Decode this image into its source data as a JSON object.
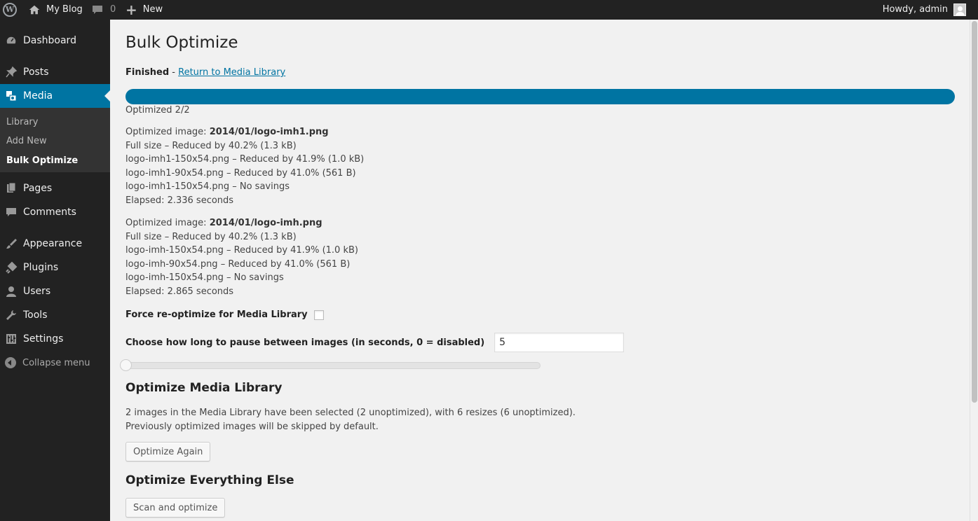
{
  "adminbar": {
    "site_name": "My Blog",
    "comments_count": "0",
    "new_label": "New",
    "howdy": "Howdy, admin"
  },
  "menu": {
    "items": [
      {
        "label": "Dashboard",
        "icon": "dashboard-icon"
      },
      {
        "label": "Posts",
        "icon": "pin-icon"
      },
      {
        "label": "Media",
        "icon": "media-icon"
      },
      {
        "label": "Pages",
        "icon": "pages-icon"
      },
      {
        "label": "Comments",
        "icon": "comment-icon"
      },
      {
        "label": "Appearance",
        "icon": "brush-icon"
      },
      {
        "label": "Plugins",
        "icon": "plug-icon"
      },
      {
        "label": "Users",
        "icon": "user-icon"
      },
      {
        "label": "Tools",
        "icon": "wrench-icon"
      },
      {
        "label": "Settings",
        "icon": "sliders-icon"
      }
    ],
    "submenu": [
      "Library",
      "Add New",
      "Bulk Optimize"
    ],
    "collapse": "Collapse menu"
  },
  "page": {
    "title": "Bulk Optimize",
    "status_label": "Finished",
    "status_sep": " - ",
    "return_link": "Return to Media Library",
    "progress_fraction": 1.0,
    "progress_text": "Optimized 2/2"
  },
  "log": [
    {
      "prefix": "Optimized image: ",
      "file": "2014/01/logo-imh1.png",
      "lines": [
        "Full size – Reduced by 40.2% (1.3 kB)",
        "logo-imh1-150x54.png – Reduced by 41.9% (1.0 kB)",
        "logo-imh1-90x54.png – Reduced by 41.0% (561 B)",
        "logo-imh1-150x54.png – No savings",
        "Elapsed: 2.336 seconds"
      ]
    },
    {
      "prefix": "Optimized image: ",
      "file": "2014/01/logo-imh.png",
      "lines": [
        "Full size – Reduced by 40.2% (1.3 kB)",
        "logo-imh-150x54.png – Reduced by 41.9% (1.0 kB)",
        "logo-imh-90x54.png – Reduced by 41.0% (561 B)",
        "logo-imh-150x54.png – No savings",
        "Elapsed: 2.865 seconds"
      ]
    }
  ],
  "form": {
    "force_label": "Force re-optimize for Media Library",
    "pause_label": "Choose how long to pause between images (in seconds, 0 = disabled)",
    "pause_value": "5",
    "slider_value": 0
  },
  "media_library": {
    "heading": "Optimize Media Library",
    "desc_line1": "2 images in the Media Library have been selected (2 unoptimized), with 6 resizes (6 unoptimized).",
    "desc_line2": "Previously optimized images will be skipped by default.",
    "button": "Optimize Again"
  },
  "everything_else": {
    "heading": "Optimize Everything Else",
    "button": "Scan and optimize"
  }
}
